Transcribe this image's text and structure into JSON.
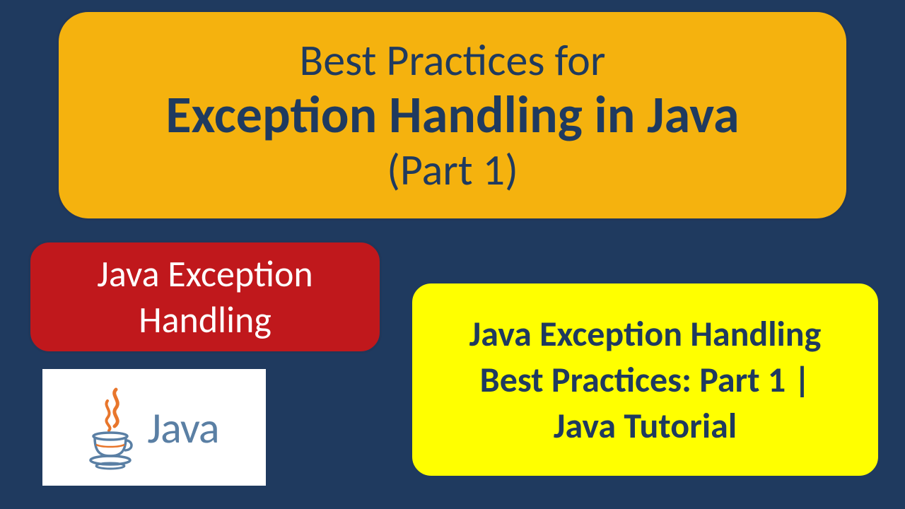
{
  "title": {
    "line1": "Best Practices for",
    "line2": "Exception Handling in Java",
    "line3": "(Part 1)"
  },
  "redBox": {
    "line1": "Java Exception",
    "line2": "Handling"
  },
  "yellowBox": {
    "line1": "Java Exception Handling",
    "line2": "Best Practices: Part 1 |",
    "line3": "Java Tutorial"
  },
  "logo": {
    "text": "Java"
  },
  "colors": {
    "background": "#1f3a5f",
    "titleBg": "#f5b20e",
    "redBg": "#c0181c",
    "yellowBg": "#ffff00",
    "javaOrange": "#e8762c",
    "javaBlue": "#5a7fa4"
  }
}
